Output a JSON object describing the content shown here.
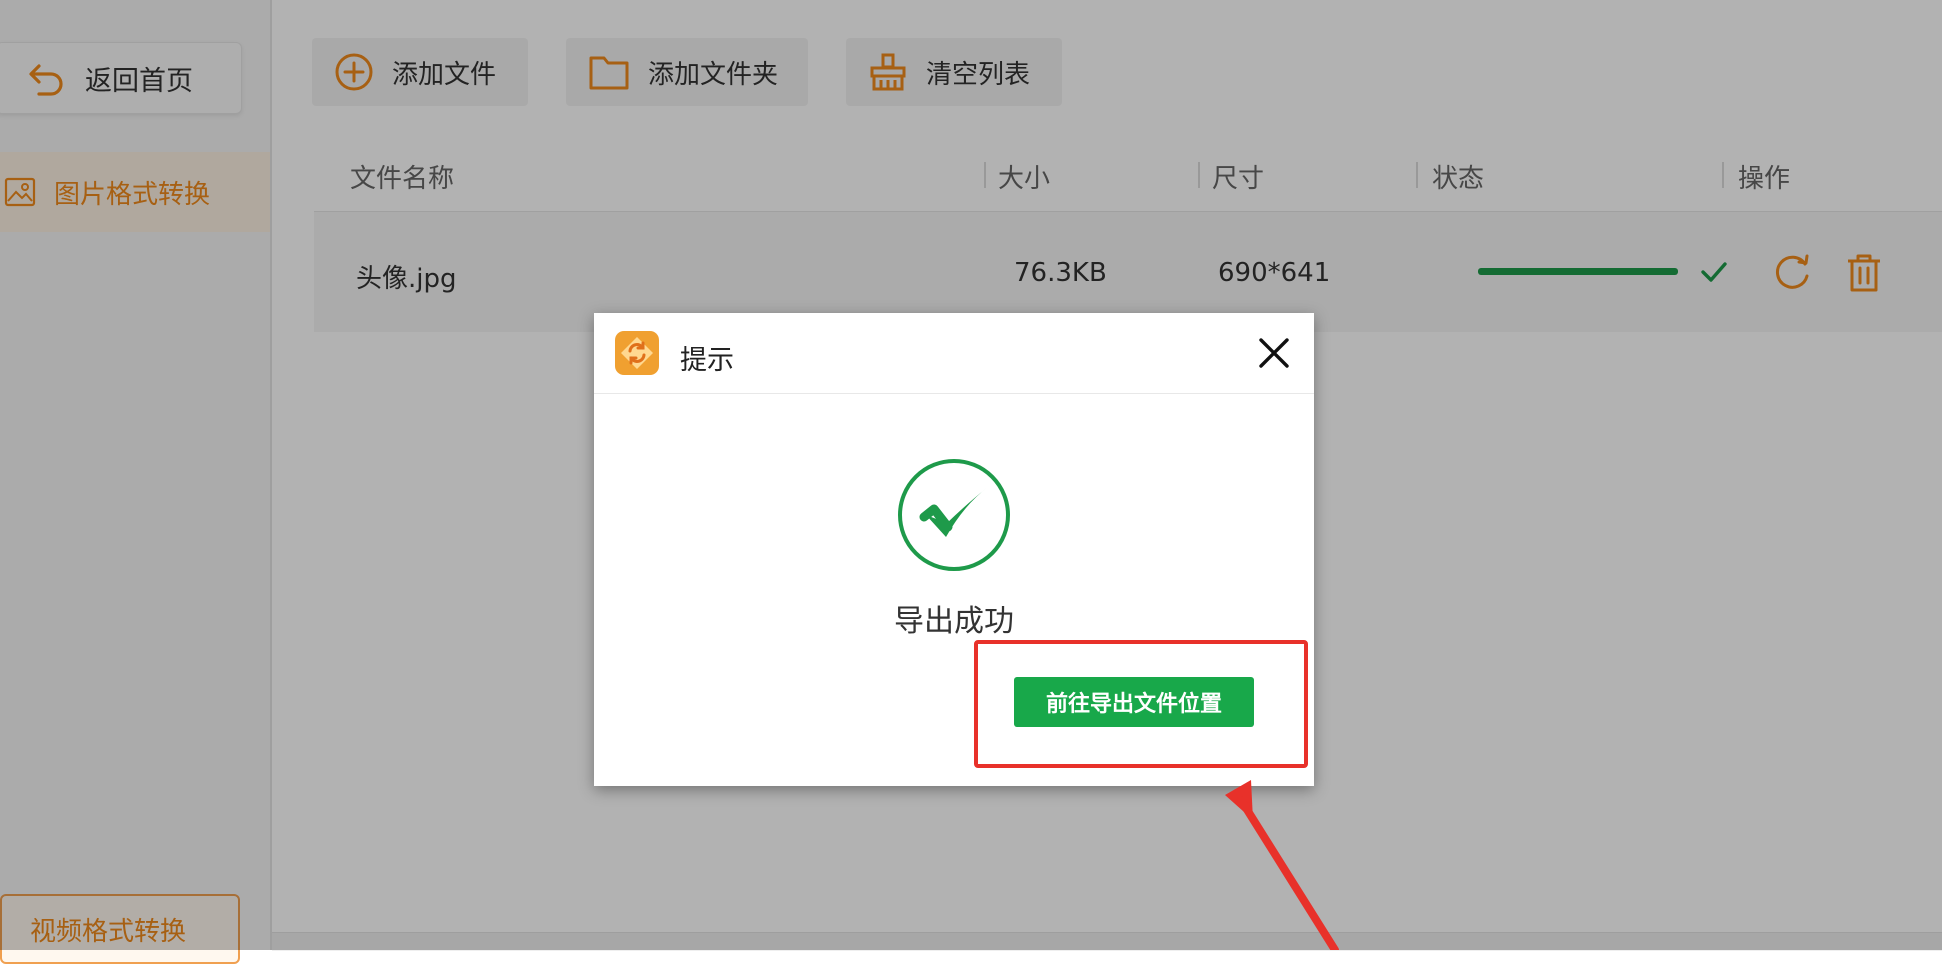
{
  "sidebar": {
    "back_label": "返回首页",
    "nav_label": "图片格式转换",
    "video_label": "视频格式转换"
  },
  "toolbar": {
    "add_file": "添加文件",
    "add_folder": "添加文件夹",
    "clear_list": "清空列表"
  },
  "table": {
    "headers": [
      "文件名称",
      "大小",
      "尺寸",
      "状态",
      "操作"
    ],
    "rows": [
      {
        "name": "头像.jpg",
        "size": "76.3KB",
        "dimensions": "690*641",
        "progress": 1.0
      }
    ]
  },
  "dialog": {
    "title": "提示",
    "message": "导出成功",
    "button": "前往导出文件位置"
  },
  "colors": {
    "accent": "#f08a1c",
    "success": "#1e9a4a",
    "highlight": "#e8312a"
  }
}
